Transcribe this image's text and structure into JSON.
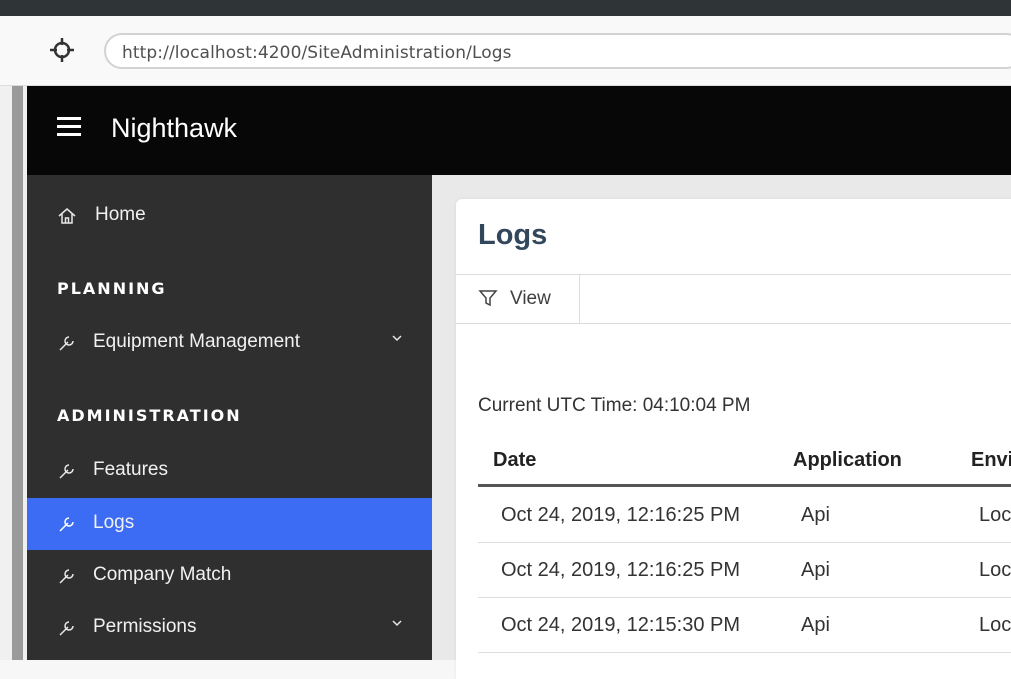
{
  "browser": {
    "url": "http://localhost:4200/SiteAdministration/Logs",
    "nav_icon": "crosshair-icon"
  },
  "app": {
    "title": "Nighthawk",
    "menu_icon": "hamburger-icon"
  },
  "sidebar": {
    "home": {
      "label": "Home",
      "icon": "home-icon"
    },
    "sections": [
      {
        "title": "PLANNING"
      },
      {
        "title": "ADMINISTRATION"
      }
    ],
    "items": [
      {
        "label": "Equipment Management",
        "icon": "wrench-icon",
        "expandable": true
      },
      {
        "label": "Features",
        "icon": "wrench-icon"
      },
      {
        "label": "Logs",
        "icon": "wrench-icon",
        "active": true
      },
      {
        "label": "Company Match",
        "icon": "wrench-icon"
      },
      {
        "label": "Permissions",
        "icon": "wrench-icon",
        "expandable": true
      }
    ],
    "active_color": "#3c6cf4"
  },
  "page": {
    "title": "Logs",
    "toolbar": {
      "view_label": "View",
      "view_icon": "filter-icon"
    },
    "utc_time": "Current UTC Time: 04:10:04 PM",
    "table": {
      "headers": [
        "Date",
        "Application",
        "Envi"
      ],
      "rows": [
        [
          "Oct 24, 2019, 12:16:25 PM",
          "Api",
          "Loc"
        ],
        [
          "Oct 24, 2019, 12:16:25 PM",
          "Api",
          "Loc"
        ],
        [
          "Oct 24, 2019, 12:15:30 PM",
          "Api",
          "Loc"
        ]
      ]
    }
  }
}
